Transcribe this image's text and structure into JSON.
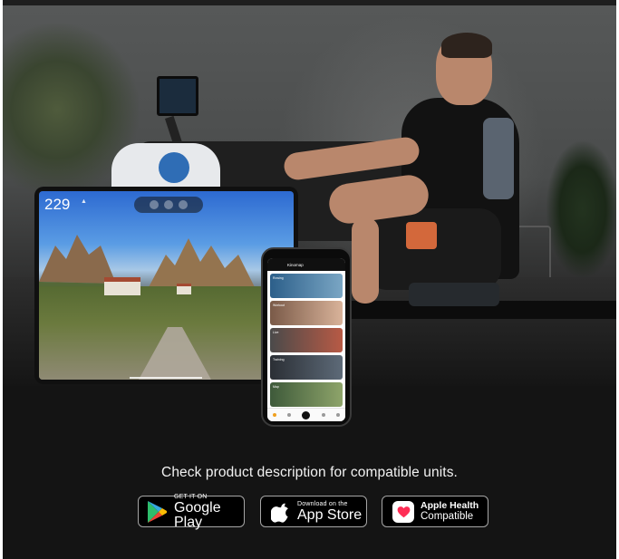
{
  "hero": {
    "tablet": {
      "metric": "229",
      "metric_unit": "▲"
    },
    "phone": {
      "app_name": "Kinomap",
      "cards": [
        "Rowing",
        "Workout",
        "Live",
        "Training",
        "Map"
      ]
    }
  },
  "compatibility_note": "Check product description for compatible units.",
  "store_badges": {
    "google_play": {
      "small": "GET IT ON",
      "big": "Google Play"
    },
    "app_store": {
      "small": "Download on the",
      "big": "App Store"
    },
    "apple_health": {
      "line1": "Apple Health",
      "line2": "Compatible"
    }
  },
  "colors": {
    "background": "#141414",
    "badge_bg": "#000000",
    "badge_border": "#a6a6a6",
    "health_heart": "#ff2d55"
  },
  "icons": [
    "google-play-icon",
    "apple-logo-icon",
    "apple-health-heart-icon"
  ]
}
